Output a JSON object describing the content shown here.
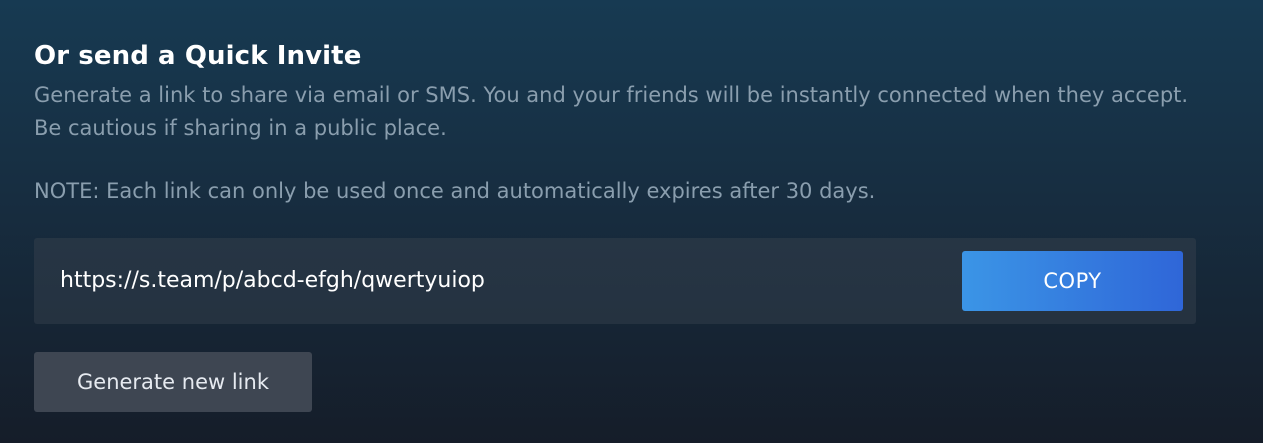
{
  "invite": {
    "title": "Or send a Quick Invite",
    "description": "Generate a link to share via email or SMS. You and your friends will be instantly connected when they accept. Be cautious if sharing in a public place.",
    "note": "NOTE: Each link can only be used once and automatically expires after 30 days.",
    "link": "https://s.team/p/abcd-efgh/qwertyuiop",
    "copy_label": "COPY",
    "generate_label": "Generate new link"
  },
  "colors": {
    "background_top": "#173a52",
    "background_bottom": "#151d29",
    "muted_text": "#8a9eae",
    "accent_start": "#3b95e6",
    "accent_end": "#2f66d8",
    "secondary_button": "#3e4652"
  }
}
